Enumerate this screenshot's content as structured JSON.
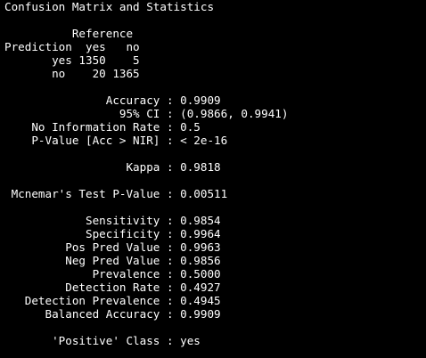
{
  "console": {
    "lines": [
      "Confusion Matrix and Statistics",
      "",
      "          Reference",
      "Prediction  yes   no",
      "       yes 1350    5",
      "       no    20 1365",
      "",
      "               Accuracy : 0.9909",
      "                 95% CI : (0.9866, 0.9941)",
      "    No Information Rate : 0.5",
      "    P-Value [Acc > NIR] : < 2e-16",
      "",
      "                  Kappa : 0.9818",
      "",
      " Mcnemar's Test P-Value : 0.00511",
      "",
      "            Sensitivity : 0.9854",
      "            Specificity : 0.9964",
      "         Pos Pred Value : 0.9963",
      "         Neg Pred Value : 0.9856",
      "             Prevalence : 0.5000",
      "         Detection Rate : 0.4927",
      "   Detection Prevalence : 0.4945",
      "      Balanced Accuracy : 0.9909",
      "",
      "       'Positive' Class : yes"
    ]
  },
  "colors": {
    "background": "#000000",
    "text": "#ffffff"
  }
}
